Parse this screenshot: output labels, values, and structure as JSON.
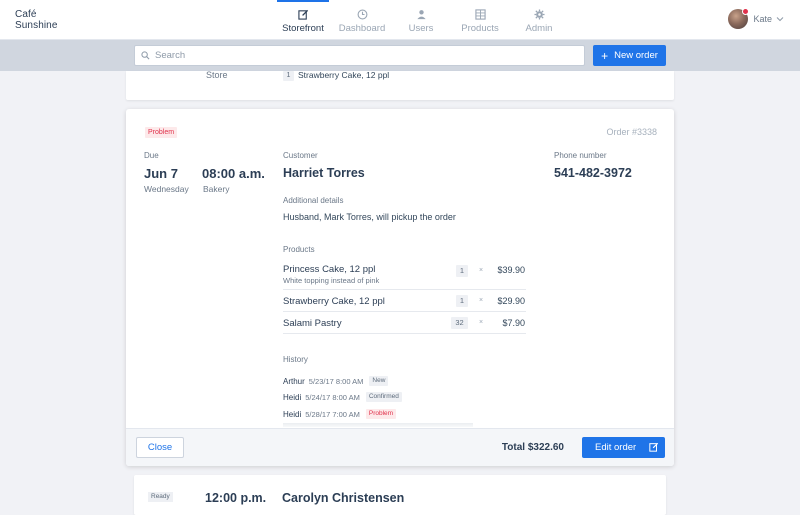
{
  "brand": {
    "line1": "Café",
    "line2": "Sunshine"
  },
  "nav": {
    "items": [
      {
        "label": "Storefront",
        "icon": "edit-icon",
        "active": true
      },
      {
        "label": "Dashboard",
        "icon": "clock-icon",
        "active": false
      },
      {
        "label": "Users",
        "icon": "user-icon",
        "active": false
      },
      {
        "label": "Products",
        "icon": "grid-icon",
        "active": false
      },
      {
        "label": "Admin",
        "icon": "gear-icon",
        "active": false
      }
    ]
  },
  "user": {
    "name": "Kate",
    "icon": "chevron-down-icon"
  },
  "search": {
    "placeholder": "Search",
    "value": ""
  },
  "new_order": {
    "label": "New order"
  },
  "previous_order": {
    "store_label": "Store",
    "product_qty": "1",
    "product_name": "Strawberry Cake, 12 ppl"
  },
  "order": {
    "status": "Problem",
    "number": "Order #3338",
    "due_label": "Due",
    "due_date": "Jun 7",
    "due_time": "08:00 a.m.",
    "due_day": "Wednesday",
    "due_type": "Bakery",
    "customer_label": "Customer",
    "customer_name": "Harriet Torres",
    "phone_label": "Phone number",
    "phone": "541-482-3972",
    "details_label": "Additional details",
    "details": "Husband, Mark Torres, will pickup the order",
    "products_label": "Products",
    "products": [
      {
        "name": "Princess Cake, 12 ppl",
        "note": "White topping instead of pink",
        "qty": "1",
        "x": "×",
        "price": "$39.90"
      },
      {
        "name": "Strawberry Cake, 12 ppl",
        "note": "",
        "qty": "1",
        "x": "×",
        "price": "$29.90"
      },
      {
        "name": "Salami Pastry",
        "note": "",
        "qty": "32",
        "x": "×",
        "price": "$7.90"
      }
    ],
    "history_label": "History",
    "history": [
      {
        "name": "Arthur",
        "time": "5/23/17 8:00 AM",
        "status": "New"
      },
      {
        "name": "Heidi",
        "time": "5/24/17 8:00 AM",
        "status": "Confirmed"
      },
      {
        "name": "Heidi",
        "time": "5/28/17 7:00 AM",
        "status": "Problem"
      }
    ],
    "close_label": "Close",
    "total": "Total $322.60",
    "edit_label": "Edit order"
  },
  "next_order": {
    "status": "Ready",
    "time": "12:00 p.m.",
    "customer": "Carolyn Christensen"
  },
  "colors": {
    "accent": "#1f74e8",
    "problem": "#e0314b",
    "problem_bg": "#fde9ea"
  }
}
